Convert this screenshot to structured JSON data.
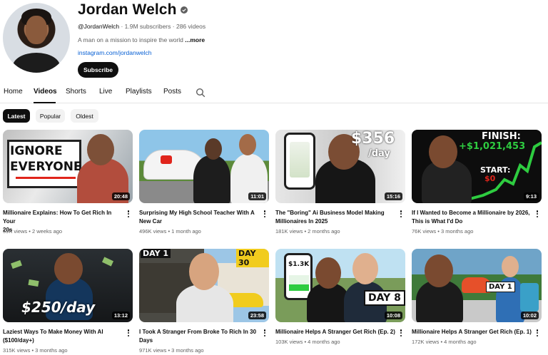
{
  "channel": {
    "name": "Jordan Welch",
    "handle": "@JordanWelch",
    "subscribers": "1.9M subscribers",
    "videos_count": "286 videos",
    "description": "A man on a mission to inspire the world",
    "more_label": "...more",
    "link": "instagram.com/jordanwelch",
    "subscribe_label": "Subscribe"
  },
  "tabs": [
    {
      "label": "Home"
    },
    {
      "label": "Videos"
    },
    {
      "label": "Shorts"
    },
    {
      "label": "Live"
    },
    {
      "label": "Playlists"
    },
    {
      "label": "Posts"
    }
  ],
  "active_tab": "Videos",
  "chips": [
    {
      "label": "Latest"
    },
    {
      "label": "Popular"
    },
    {
      "label": "Oldest"
    }
  ],
  "active_chip": "Latest",
  "videos": [
    {
      "title_line1": "Millionaire Explains: How To Get Rich In Your",
      "title_line2": "20s",
      "views": "59K views",
      "age": "2 weeks ago",
      "duration": "20:48",
      "thumb_text": [
        "IGNORE",
        "EVERYONE"
      ]
    },
    {
      "title_line1": "Surprising My High School Teacher With A",
      "title_line2": "New Car",
      "views": "496K views",
      "age": "1 month ago",
      "duration": "11:01"
    },
    {
      "title_line1": "The \"Boring\" Ai Business Model Making",
      "title_line2": "Millionaires In 2025",
      "views": "181K views",
      "age": "2 months ago",
      "duration": "15:16",
      "thumb_text": [
        "$356",
        "/day"
      ]
    },
    {
      "title_line1": "If I Wanted to Become a Millionaire by 2026,",
      "title_line2": "This is What I'd Do",
      "views": "76K views",
      "age": "3 months ago",
      "duration": "9:13",
      "thumb_text": [
        "FINISH:",
        "+$1,021,453",
        "START:",
        "$0"
      ]
    },
    {
      "title_line1": "Laziest Ways To Make Money With AI",
      "title_line2": "($100/day+)",
      "views": "315K views",
      "age": "3 months ago",
      "duration": "13:12",
      "thumb_text": [
        "$250/day"
      ]
    },
    {
      "title_line1": "I Took A Stranger From Broke To Rich In 30",
      "title_line2": "Days",
      "views": "971K views",
      "age": "3 months ago",
      "duration": "23:58",
      "thumb_text": [
        "DAY 1",
        "DAY 30"
      ]
    },
    {
      "title_line1": "Millionaire Helps A Stranger Get Rich (Ep. 2)",
      "title_line2": "",
      "views": "103K views",
      "age": "4 months ago",
      "duration": "10:08",
      "thumb_text": [
        "DAY 8",
        "$1.3K"
      ]
    },
    {
      "title_line1": "Millionaire Helps A Stranger Get Rich (Ep. 1)",
      "title_line2": "",
      "views": "172K views",
      "age": "4 months ago",
      "duration": "10:02",
      "thumb_text": [
        "DAY 1"
      ]
    }
  ],
  "colors": {
    "accent_link": "#065fd4",
    "text_primary": "#0f0f0f",
    "text_secondary": "#606060",
    "chip_bg": "#f2f2f2",
    "finish_green": "#2ecc40"
  },
  "icons": [
    "verified-icon",
    "search-icon",
    "more-vert-icon"
  ]
}
